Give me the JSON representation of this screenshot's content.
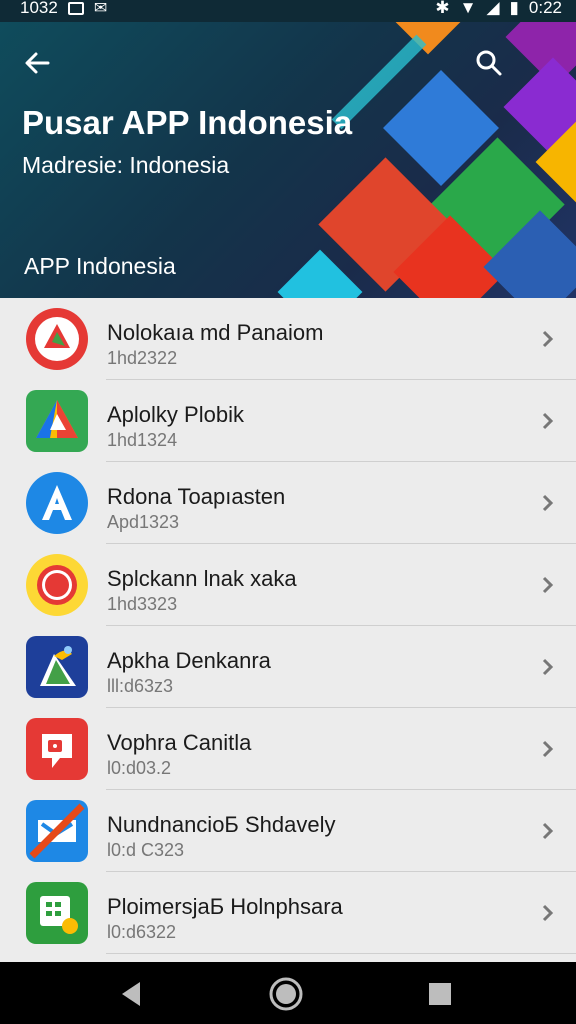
{
  "status_bar": {
    "time_left": "1032",
    "time_right": "0:22"
  },
  "header": {
    "title": "Pusar APP Indonesia",
    "subtitle": "Madresie: Indonesia",
    "section_label": "APP Indonesia"
  },
  "apps": [
    {
      "name": "Nolokaıa md Panaiom",
      "sub": "1hd2322",
      "icon": "triangle-logo-icon",
      "color": "#e53935"
    },
    {
      "name": "Aplolky Plobik",
      "sub": "1hd1324",
      "icon": "drive-triangle-icon",
      "color": "#34a853"
    },
    {
      "name": "Rdona Toapıasten",
      "sub": "Apd1323",
      "icon": "letter-a-icon",
      "color": "#1e88e5"
    },
    {
      "name": "Splckann lnak xaka",
      "sub": "1hd3323",
      "icon": "ring-icon",
      "color": "#fdd835"
    },
    {
      "name": "Apkha Denkanra",
      "sub": "lll:d63z3",
      "icon": "bird-logo-icon",
      "color": "#1e3f9a"
    },
    {
      "name": "Vophra Canitla",
      "sub": "l0:d03.2",
      "icon": "chat-tag-icon",
      "color": "#e53935"
    },
    {
      "name": "NundnancioБ Shdavely",
      "sub": "l0:d C323",
      "icon": "slash-logo-icon",
      "color": "#1e88e5"
    },
    {
      "name": "PloimersjaБ Holnphsara",
      "sub": "l0:d6322",
      "icon": "calendar-icon",
      "color": "#2e9e3e"
    }
  ],
  "colors": {
    "header_dark": "#13344a",
    "list_bg": "#ececec",
    "nav_bg": "#000000"
  }
}
